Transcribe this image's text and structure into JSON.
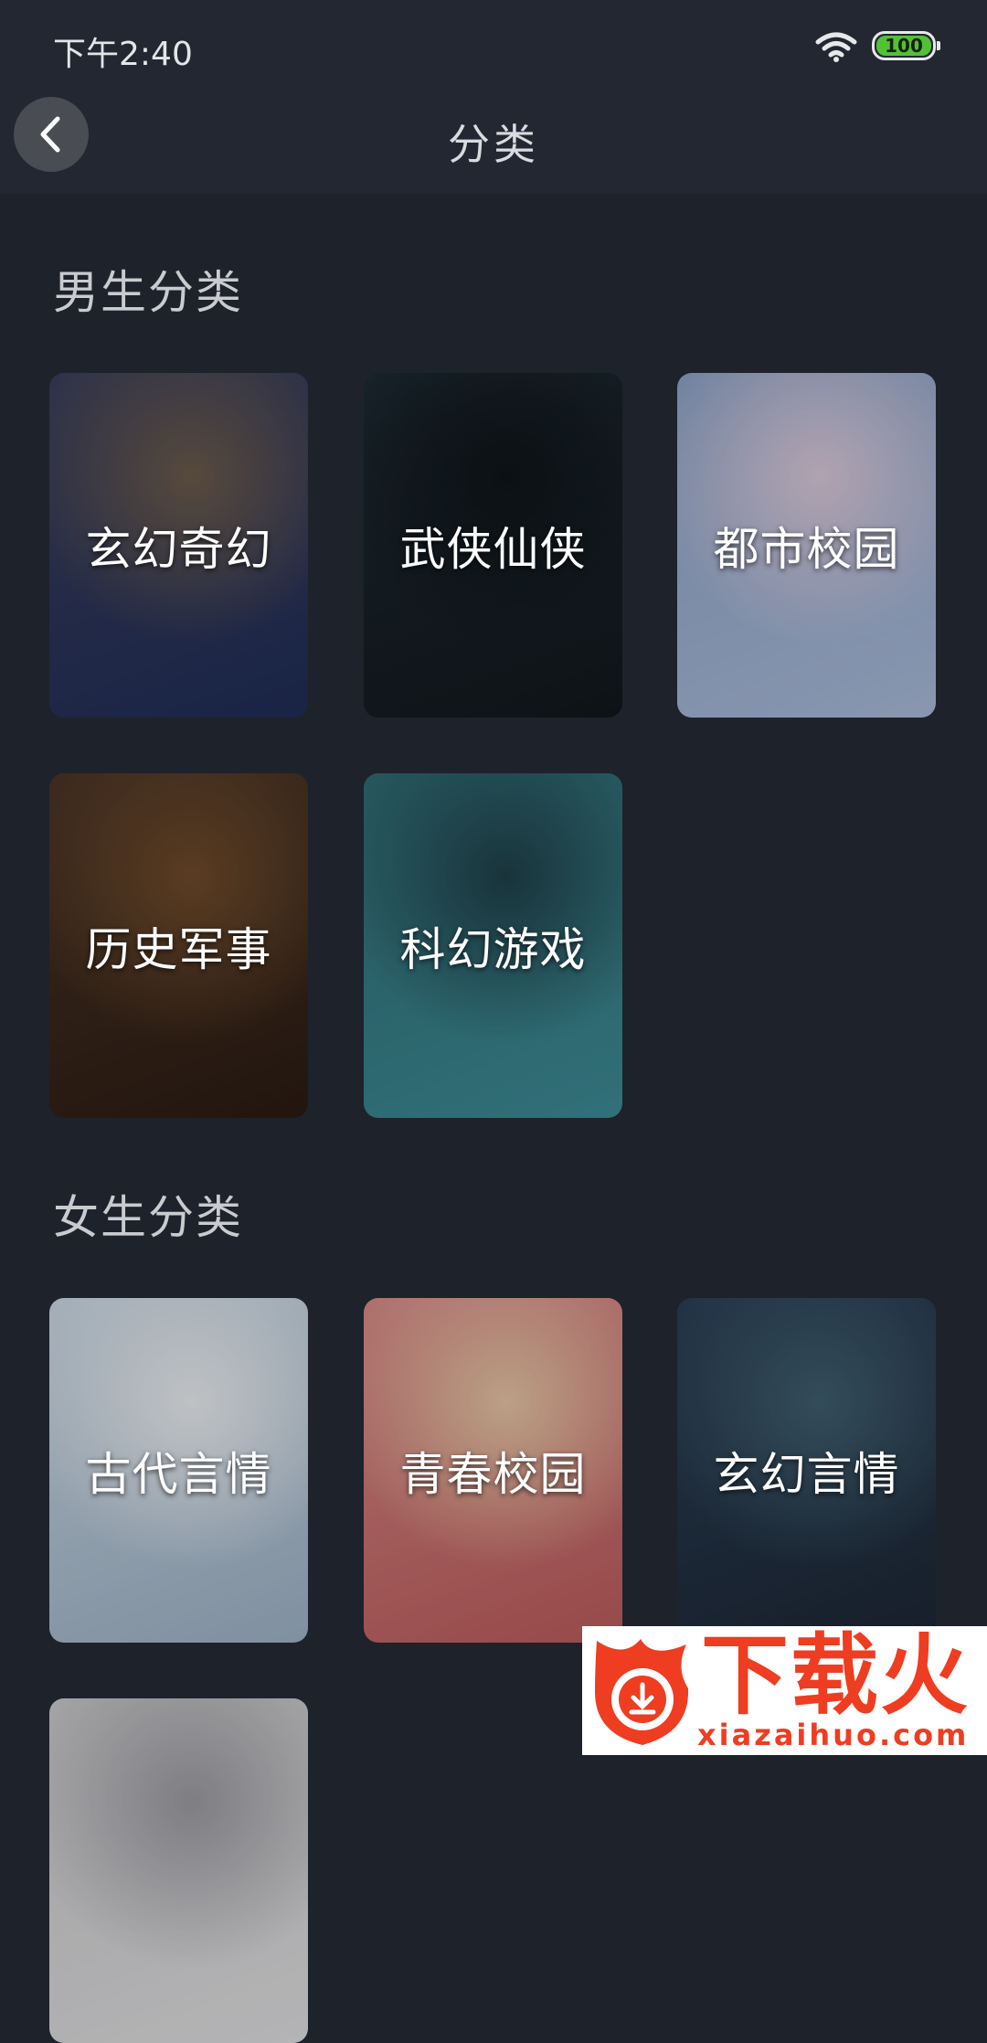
{
  "status_bar": {
    "time": "下午2:40",
    "battery": "100"
  },
  "nav": {
    "title": "分类"
  },
  "sections": [
    {
      "title": "男生分类",
      "cards": [
        {
          "label": "玄幻奇幻",
          "colors": [
            "#3a3e5a",
            "#6b5a4a",
            "#1f2c55"
          ]
        },
        {
          "label": "武侠仙侠",
          "colors": [
            "#1d2a33",
            "#0e1418",
            "#11171b"
          ]
        },
        {
          "label": "都市校园",
          "colors": [
            "#8aa0c4",
            "#d8c7d8",
            "#a7b8d6"
          ]
        },
        {
          "label": "历史军事",
          "colors": [
            "#4a3426",
            "#6e4a2a",
            "#2a1b12"
          ]
        },
        {
          "label": "科幻游戏",
          "colors": [
            "#2f6a72",
            "#1f3f48",
            "#3c8a94"
          ]
        }
      ]
    },
    {
      "title": "女生分类",
      "cards": [
        {
          "label": "古代言情",
          "colors": [
            "#c8d6e2",
            "#e9ecef",
            "#9cb0c4"
          ]
        },
        {
          "label": "青春校园",
          "colors": [
            "#d68a86",
            "#e4c4a4",
            "#b85a5a"
          ]
        },
        {
          "label": "玄幻言情",
          "colors": [
            "#2a3f55",
            "#3f5e6e",
            "#1c2634"
          ]
        },
        {
          "label": "",
          "colors": [
            "#c7c7c9",
            "#9a9aa0",
            "#dcdcde"
          ]
        }
      ]
    }
  ],
  "watermark": {
    "brand": "下载火",
    "url": "xiazaihuo.com"
  }
}
